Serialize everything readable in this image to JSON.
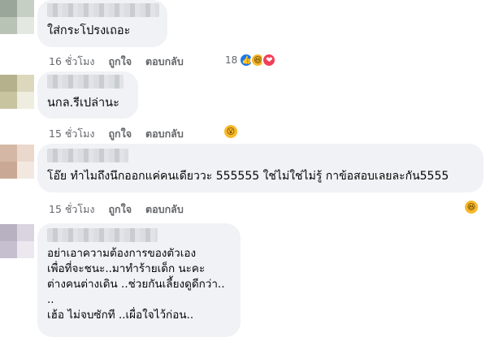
{
  "comments": [
    {
      "text_lines": [
        "ใส่กระโปรงเถอะ"
      ],
      "time": "16 ชั่วโมง",
      "like_label": "ถูกใจ",
      "reply_label": "ตอบกลับ",
      "reaction_count": "18",
      "reactions": [
        "like-icon",
        "haha-icon",
        "love-icon"
      ]
    },
    {
      "text_lines": [
        "นกล.รีเปล่านะ"
      ],
      "time": "15 ชั่วโมง",
      "like_label": "ถูกใจ",
      "reply_label": "ตอบกลับ",
      "reactions": [
        "wow-icon"
      ]
    },
    {
      "text_lines": [
        "โอ๊ย ทำไมถึงนึกออกแค่คนเดียววะ 555555 ใช่ไม่ใช่ไม่รู้ กาข้อสอบเลยละกัน5555"
      ],
      "time": "15 ชั่วโมง",
      "like_label": "ถูกใจ",
      "reply_label": "ตอบกลับ",
      "reactions": [
        "haha-icon"
      ]
    },
    {
      "text_lines": [
        "อย่าเอาความต้องการของตัวเอง",
        "เพื่อที่จะชนะ..มาทำร้ายเด็ก นะคะ",
        "ต่างคนต่างเดิน ..ช่วยกันเลี้ยงดูดีกว่า..",
        "..",
        "เฮ้อ ไม่จบซักที ..เผื่อใจไว้ก่อน.."
      ]
    }
  ],
  "colors": {
    "bubble": "#f0f2f5",
    "meta_text": "#65676b",
    "like": "#1877f2",
    "love": "#f33e58",
    "haha": "#f7b928"
  }
}
